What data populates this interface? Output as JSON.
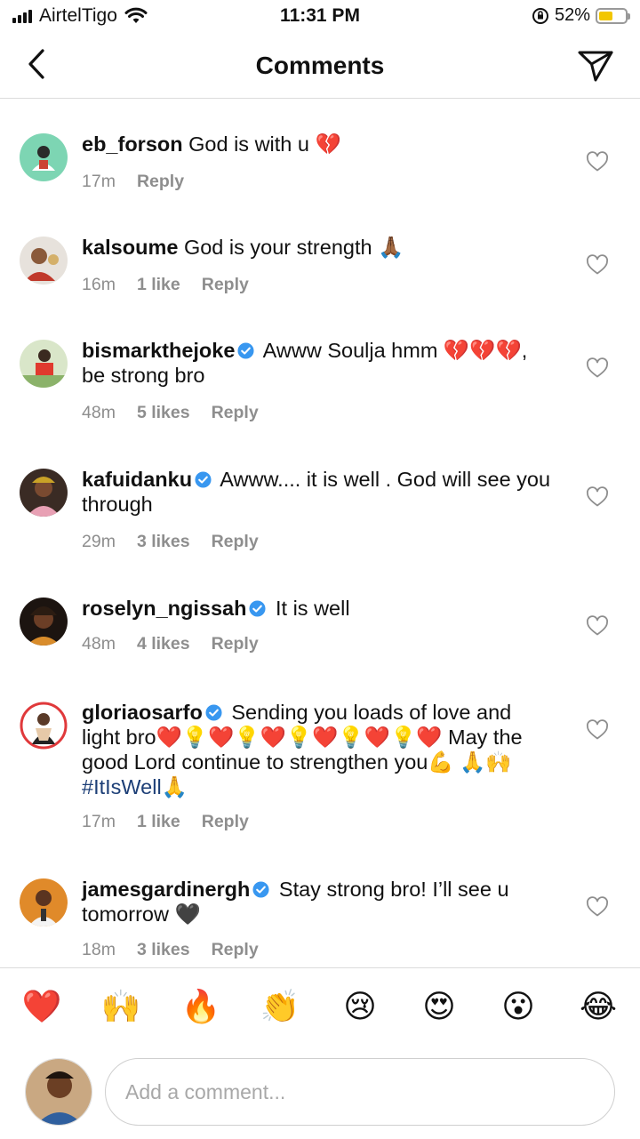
{
  "status_bar": {
    "carrier": "AirtelTigo",
    "time": "11:31 PM",
    "battery": "52%",
    "battery_level": 0.52
  },
  "header": {
    "title": "Comments"
  },
  "comments": [
    {
      "user": "eb_forson",
      "verified": false,
      "text": "God  is with u 💔",
      "time": "17m",
      "likes": "",
      "reply": "Reply"
    },
    {
      "user": "kalsoume",
      "verified": false,
      "text": "God is your strength 🙏🏾",
      "time": "16m",
      "likes": "1 like",
      "reply": "Reply"
    },
    {
      "user": "bismarkthejoke",
      "verified": true,
      "text": "Awww Soulja hmm 💔💔💔, be strong bro",
      "time": "48m",
      "likes": "5 likes",
      "reply": "Reply"
    },
    {
      "user": "kafuidanku",
      "verified": true,
      "text": "Awww.... it is well . God will see you through",
      "time": "29m",
      "likes": "3 likes",
      "reply": "Reply"
    },
    {
      "user": "roselyn_ngissah",
      "verified": true,
      "text": "It is well",
      "time": "48m",
      "likes": "4 likes",
      "reply": "Reply"
    },
    {
      "user": "gloriaosarfo",
      "verified": true,
      "text": "Sending you loads of love and light bro❤️💡❤️💡❤️💡❤️💡❤️💡❤️ May the good Lord continue to strengthen you💪 🙏🙌 ",
      "hashtag": "#ItIsWell",
      "after": "🙏",
      "time": "17m",
      "likes": "1 like",
      "reply": "Reply"
    },
    {
      "user": "jamesgardinergh",
      "verified": true,
      "text": "Stay strong bro! I’ll see u tomorrow 🖤",
      "time": "18m",
      "likes": "3 likes",
      "reply": "Reply"
    }
  ],
  "emoji_bar": [
    "❤️",
    "🙌",
    "🔥",
    "👏",
    "😢",
    "😍",
    "😮",
    "😂"
  ],
  "composer": {
    "placeholder": "Add a comment..."
  },
  "icons": {
    "back": "chevron-left-icon",
    "send": "paper-plane-icon",
    "like": "heart-outline-icon",
    "verified": "verified-badge-icon"
  },
  "colors": {
    "verified": "#3897f0",
    "meta": "#8e8e8e",
    "hashtag": "#1d3f77",
    "battery": "#f2c600"
  }
}
